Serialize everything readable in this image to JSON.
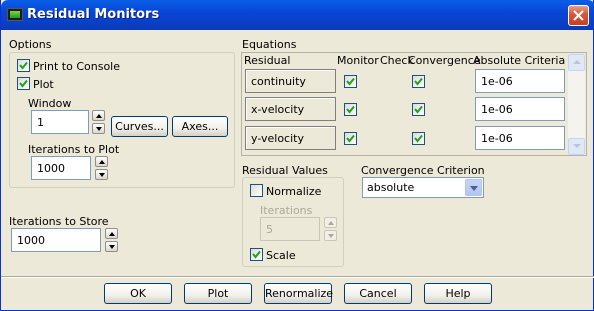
{
  "window": {
    "title": "Residual Monitors"
  },
  "options": {
    "title": "Options",
    "print_to_console": {
      "label": "Print to Console",
      "checked": true
    },
    "plot": {
      "label": "Plot",
      "checked": true
    },
    "window_label": "Window",
    "window_value": "1",
    "curves_button": "Curves...",
    "axes_button": "Axes...",
    "iterations_to_plot_label": "Iterations to Plot",
    "iterations_to_plot_value": "1000"
  },
  "iterations_to_store": {
    "label": "Iterations to Store",
    "value": "1000"
  },
  "equations": {
    "title": "Equations",
    "headers": {
      "residual": "Residual",
      "monitor": "Monitor",
      "check": "Check",
      "convergence": "Convergence",
      "criteria": "Absolute Criteria"
    },
    "rows": [
      {
        "name": "continuity",
        "monitor": true,
        "convergence": true,
        "criteria": "1e-06"
      },
      {
        "name": "x-velocity",
        "monitor": true,
        "convergence": true,
        "criteria": "1e-06"
      },
      {
        "name": "y-velocity",
        "monitor": true,
        "convergence": true,
        "criteria": "1e-06"
      }
    ]
  },
  "residual_values": {
    "title": "Residual Values",
    "normalize": {
      "label": "Normalize",
      "checked": false
    },
    "iterations_label": "Iterations",
    "iterations_value": "5",
    "scale": {
      "label": "Scale",
      "checked": true
    }
  },
  "convergence_criterion": {
    "label": "Convergence Criterion",
    "value": "absolute"
  },
  "buttons": {
    "ok": "OK",
    "plot": "Plot",
    "renormalize": "Renormalize",
    "cancel": "Cancel",
    "help": "Help"
  }
}
